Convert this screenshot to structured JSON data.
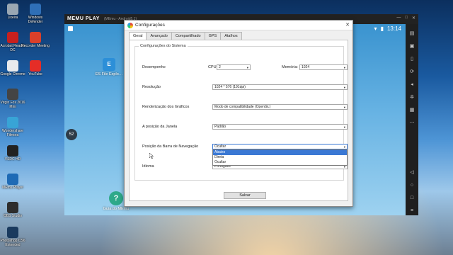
{
  "desktop": {
    "icons": [
      {
        "label": "Lixeira",
        "icon": "recycle-bin-icon",
        "color": "#9aa7b3"
      },
      {
        "label": "Windows Defender",
        "icon": "defender-icon",
        "color": "#2f6fb7"
      },
      {
        "label": "Acrobat Reader DC",
        "icon": "acrobat-icon",
        "color": "#c8201e"
      },
      {
        "label": "Recorder Meeting",
        "icon": "recorder-icon",
        "color": "#d9402a"
      },
      {
        "label": "Google Chrome",
        "icon": "chrome-icon",
        "color": "#e8eaed"
      },
      {
        "label": "YouTube",
        "icon": "youtube-icon",
        "color": "#e52d27"
      },
      {
        "label": "Virgin Fox 2016 Mini",
        "icon": "app-icon",
        "color": "#444444"
      },
      {
        "label": "Wondershare Filmora",
        "icon": "filmora-icon",
        "color": "#38a4d6"
      },
      {
        "label": "VSDC HD",
        "icon": "vsdc-icon",
        "color": "#222222"
      },
      {
        "label": "MEmu Player",
        "icon": "memu-icon",
        "color": "#1e6ab5"
      },
      {
        "label": "OBS Studio",
        "icon": "obs-icon",
        "color": "#2d2d2d"
      },
      {
        "label": "Photoshop CS6 Extended",
        "icon": "photoshop-icon",
        "color": "#1a3a5e"
      }
    ]
  },
  "memu": {
    "logo": "MEMU PLAY",
    "subtitle": "(MEmu - Android5.1)",
    "controls": [
      "—",
      "□",
      "✕"
    ],
    "time": "13:14",
    "badge": "52",
    "apps": [
      {
        "label": "ES File Explo…",
        "icon": "es-file-explorer-icon"
      },
      {
        "label": "Guia do MEmu",
        "icon": "help-icon"
      }
    ],
    "toolbar": [
      "keyboard-icon",
      "screenshot-icon",
      "shake-icon",
      "rotate-icon",
      "volume-icon",
      "settings-icon",
      "apk-icon",
      "more-icon",
      "back-icon",
      "home-icon",
      "recent-apps-icon",
      "menu-icon"
    ]
  },
  "dialog": {
    "title": "Configurações",
    "close": "✕",
    "tabs": [
      "Geral",
      "Avançado",
      "Compartilhado",
      "GPS",
      "Atalhos"
    ],
    "active_tab": "Geral",
    "group_title": "Configurações do Sistema",
    "performance": {
      "label": "Desempenho",
      "cpu_label": "CPU:",
      "cpu_value": "2",
      "memory_label": "Memória:",
      "memory_value": "1024"
    },
    "resolution": {
      "label": "Resolução",
      "value": "1024 * 576 (191dpi)"
    },
    "rendering": {
      "label": "Renderização dos Gráficos",
      "value": "Modo de compatibilidade (OpenGL)"
    },
    "window_position": {
      "label": "A posição da Janela",
      "value": "Padrão"
    },
    "nav_bar": {
      "label": "Posição da Barra de Navegação",
      "value": "Ocultar",
      "options": [
        "Abaixo",
        "Direta",
        "Ocultar"
      ],
      "highlighted": "Abaixo"
    },
    "language": {
      "label": "Idioma",
      "value": "Português"
    },
    "save_label": "Salvar"
  }
}
